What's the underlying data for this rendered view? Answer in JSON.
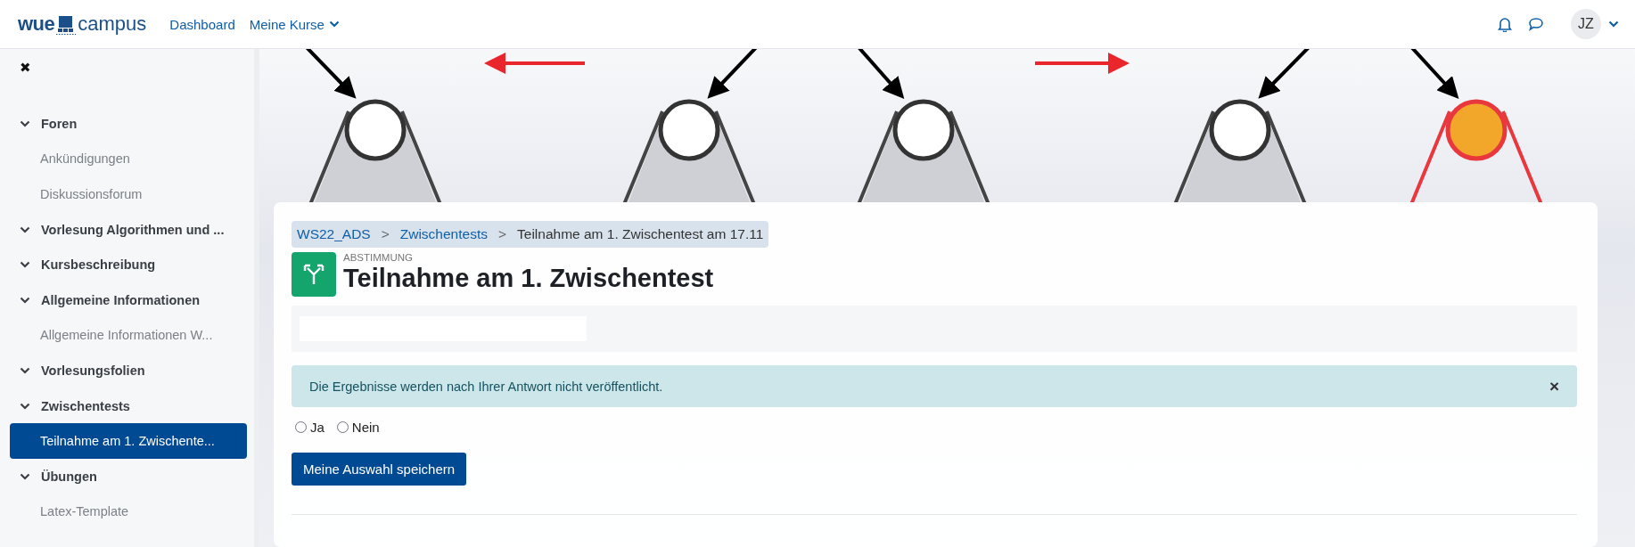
{
  "header": {
    "logo": {
      "left": "wue",
      "right": "campus"
    },
    "nav": [
      {
        "label": "Dashboard",
        "dropdown": false
      },
      {
        "label": "Meine Kurse",
        "dropdown": true
      }
    ],
    "avatar": "JZ"
  },
  "sidebar": {
    "close": "✖",
    "sections": [
      {
        "label": "Foren",
        "expanded": true,
        "children": [
          {
            "label": "Ankündigungen",
            "selected": false
          },
          {
            "label": "Diskussionsforum",
            "selected": false
          }
        ]
      },
      {
        "label": "Vorlesung Algorithmen und ...",
        "expanded": true
      },
      {
        "label": "Kursbeschreibung",
        "expanded": true
      },
      {
        "label": "Allgemeine Informationen",
        "expanded": true,
        "children": [
          {
            "label": "Allgemeine Informationen W...",
            "selected": false
          }
        ]
      },
      {
        "label": "Vorlesungsfolien",
        "expanded": true
      },
      {
        "label": "Zwischentests",
        "expanded": true,
        "children": [
          {
            "label": "Teilnahme am 1. Zwischente...",
            "selected": true
          }
        ]
      },
      {
        "label": "Übungen",
        "expanded": true,
        "children": [
          {
            "label": "Latex-Template",
            "selected": false
          }
        ]
      }
    ]
  },
  "breadcrumb": [
    {
      "label": "WS22_ADS",
      "link": true
    },
    {
      "label": "Zwischentests",
      "link": true
    },
    {
      "label": "Teilnahme am 1. Zwischentest am 17.11",
      "link": false
    }
  ],
  "breadcrumb_separator": ">",
  "activity": {
    "type": "ABSTIMMUNG",
    "title": "Teilnahme am 1. Zwischentest"
  },
  "alert": {
    "text": "Die Ergebnisse werden nach Ihrer Antwort nicht veröffentlicht.",
    "close": "×"
  },
  "options": [
    {
      "label": "Ja",
      "selected": false
    },
    {
      "label": "Nein",
      "selected": false
    }
  ],
  "submit": "Meine Auswahl speichern"
}
